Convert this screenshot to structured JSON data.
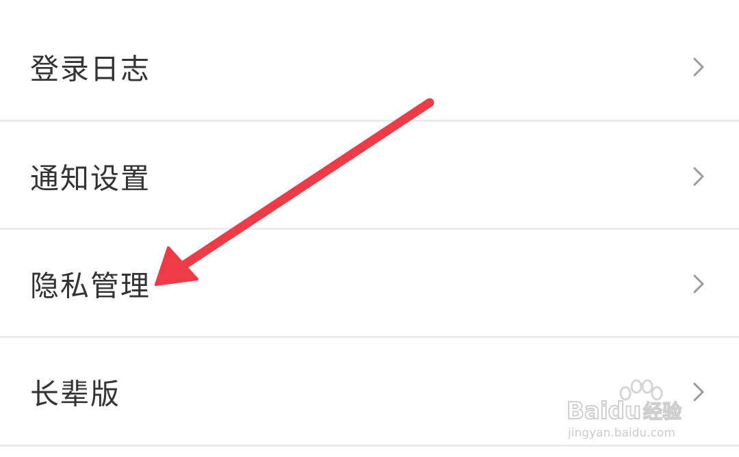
{
  "settings": {
    "items": [
      {
        "label": "登录日志"
      },
      {
        "label": "通知设置"
      },
      {
        "label": "隐私管理"
      },
      {
        "label": "长辈版"
      }
    ]
  },
  "annotation": {
    "arrow_color": "#ef3a47",
    "arrow_target": "隐私管理"
  },
  "watermark": {
    "brand": "Baidu",
    "brand_suffix": "经验",
    "url": "jingyan.baidu.com"
  },
  "colors": {
    "text": "#333333",
    "chevron": "#9a9a9a",
    "divider": "#ebebeb",
    "background": "#ffffff"
  }
}
